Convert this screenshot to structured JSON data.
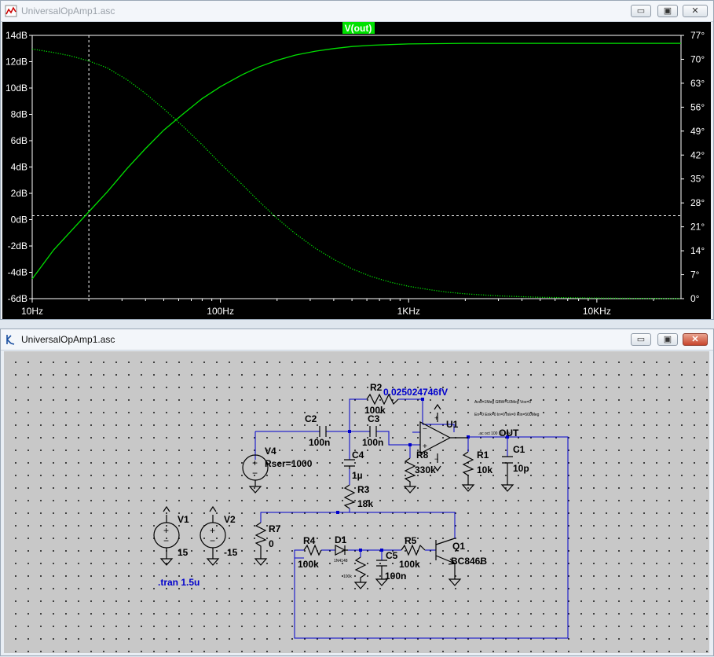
{
  "plot_window": {
    "title": "UniversalOpAmp1.asc",
    "controls": {
      "minimize": "▭",
      "restore": "▣",
      "close": "✕"
    }
  },
  "schematic_window": {
    "title": "UniversalOpAmp1.asc",
    "controls": {
      "minimize": "▭",
      "restore": "▣",
      "close": "✕"
    }
  },
  "chart_data": {
    "type": "line",
    "title": "V(out)",
    "x_scale": "log",
    "xlim": [
      10,
      28000
    ],
    "x_ticks": [
      {
        "value": 10,
        "label": "10Hz"
      },
      {
        "value": 100,
        "label": "100Hz"
      },
      {
        "value": 1000,
        "label": "1KHz"
      },
      {
        "value": 10000,
        "label": "10KHz"
      }
    ],
    "y_left": {
      "lim": [
        -6,
        14
      ],
      "ticks": [
        {
          "value": 14,
          "label": "14dB"
        },
        {
          "value": 12,
          "label": "12dB"
        },
        {
          "value": 10,
          "label": "10dB"
        },
        {
          "value": 8,
          "label": "8dB"
        },
        {
          "value": 6,
          "label": "6dB"
        },
        {
          "value": 4,
          "label": "4dB"
        },
        {
          "value": 2,
          "label": "2dB"
        },
        {
          "value": 0,
          "label": "0dB"
        },
        {
          "value": -2,
          "label": "-2dB"
        },
        {
          "value": -4,
          "label": "-4dB"
        },
        {
          "value": -6,
          "label": "-6dB"
        }
      ]
    },
    "y_right": {
      "lim": [
        0,
        77
      ],
      "ticks": [
        {
          "value": 77,
          "label": "77°"
        },
        {
          "value": 70,
          "label": "70°"
        },
        {
          "value": 63,
          "label": "63°"
        },
        {
          "value": 56,
          "label": "56°"
        },
        {
          "value": 49,
          "label": "49°"
        },
        {
          "value": 42,
          "label": "42°"
        },
        {
          "value": 35,
          "label": "35°"
        },
        {
          "value": 28,
          "label": "28°"
        },
        {
          "value": 21,
          "label": "21°"
        },
        {
          "value": 14,
          "label": "14°"
        },
        {
          "value": 7,
          "label": "7°"
        },
        {
          "value": 0,
          "label": "0°"
        }
      ]
    },
    "series": [
      {
        "name": "magnitude",
        "axis": "left",
        "style": "solid",
        "x": [
          10,
          13,
          16,
          20,
          25,
          32,
          40,
          50,
          63,
          80,
          100,
          130,
          160,
          200,
          250,
          320,
          400,
          500,
          630,
          800,
          1000,
          2000,
          5000,
          10000,
          28000
        ],
        "y": [
          -4.5,
          -2.3,
          -0.9,
          0.6,
          2.1,
          3.9,
          5.4,
          6.8,
          8.0,
          9.2,
          10.1,
          11.0,
          11.6,
          12.1,
          12.5,
          12.8,
          13.0,
          13.15,
          13.25,
          13.3,
          13.35,
          13.4,
          13.4,
          13.4,
          13.4
        ]
      },
      {
        "name": "phase",
        "axis": "right",
        "style": "dotted",
        "x": [
          10,
          13,
          16,
          20,
          25,
          32,
          40,
          50,
          63,
          80,
          100,
          130,
          160,
          200,
          250,
          320,
          400,
          500,
          630,
          800,
          1000,
          1300,
          1600,
          2000,
          3000,
          5000,
          10000,
          28000
        ],
        "y": [
          73.0,
          72.0,
          71.0,
          69.5,
          67.5,
          64.0,
          60.0,
          55.5,
          50.5,
          45.0,
          39.5,
          33.5,
          28.5,
          23.5,
          19.0,
          14.7,
          11.5,
          8.7,
          6.5,
          4.8,
          3.6,
          2.6,
          1.9,
          1.4,
          0.8,
          0.4,
          0.15,
          0.0
        ]
      }
    ],
    "cursors": {
      "x": 20,
      "y_left": 0.3
    },
    "colors": {
      "background": "#000000",
      "axis": "#ffffff",
      "trace": "#00e000",
      "title_bg": "#00e000",
      "title_text": "#ffffff"
    }
  },
  "schematic": {
    "colors": {
      "wire": "#0000cc",
      "component": "#000000",
      "text": "#000000",
      "highlight": "#0000cc"
    },
    "labels": {
      "R2": "R2",
      "R2_val": "100k",
      "C2": "C2",
      "C2_val": "100n",
      "C3": "C3",
      "C3_val": "100n",
      "U1": "U1",
      "R8": "R8",
      "R8_val": "330k",
      "R1": "R1",
      "R1_val": "10k",
      "OUT": "OUT",
      "C1": "C1",
      "C1_val": "10p",
      "C4": "C4",
      "C4_val": "1µ",
      "R3": "R3",
      "R3_val": "18k",
      "V4": "V4",
      "V4_val": "Rser=1000",
      "V1": "V1",
      "V1_val": "15",
      "V2": "V2",
      "V2_val": "-15",
      "R7": "R7",
      "R7_val": "0",
      "R4": "R4",
      "R4_val": "100k",
      "D1": "D1",
      "D1_small": "1N4148",
      "R6_small": "100k",
      "C5": "C5",
      "C5_val": "100n",
      "R5": "R5",
      "R5_val": "100k",
      "Q1": "Q1",
      "Q1_val": "BC846B",
      "tran": ".tran 1.5u",
      "probe_value": "0.025024746fV",
      "spice1": "Avol=1Meg GBW=10Meg Vos=0",
      "spice2": "En=0 Enk=0 In=0 Ink=0 Rin=500Meg",
      "ac_directive": ".ac oct 100 10 30k",
      "plus": "+",
      "minus": "−"
    }
  }
}
